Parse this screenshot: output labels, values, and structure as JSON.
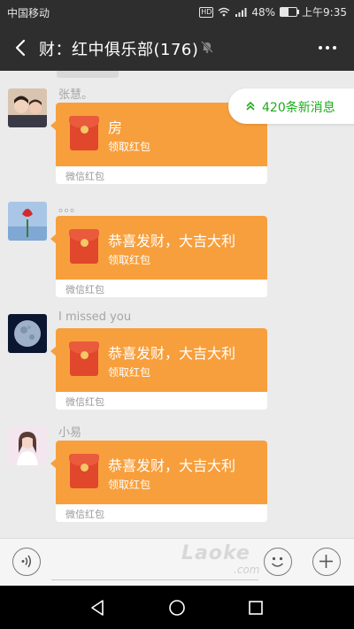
{
  "status_bar": {
    "carrier": "中国移动",
    "network_badge": "HD",
    "battery": "48%",
    "battery_level": 0.48,
    "time": "上午9:35"
  },
  "header": {
    "back_icon": "back-arrow-icon",
    "title": "财：红中俱乐部(176)",
    "mute_icon": "bell-muted-icon",
    "more_icon": "more-dots-icon"
  },
  "new_messages": {
    "icon": "double-chevron-up-icon",
    "label": "420条新消息"
  },
  "messages": [
    {
      "nickname": "张慧。",
      "packet_title": "房",
      "packet_action": "领取红包",
      "packet_footer": "微信红包"
    },
    {
      "nickname": "。。。",
      "packet_title": "恭喜发财，大吉大利",
      "packet_action": "领取红包",
      "packet_footer": "微信红包"
    },
    {
      "nickname": "I missed you",
      "packet_title": "恭喜发财，大吉大利",
      "packet_action": "领取红包",
      "packet_footer": "微信红包"
    },
    {
      "nickname": "小易",
      "packet_title": "恭喜发财，大吉大利",
      "packet_action": "领取红包",
      "packet_footer": "微信红包"
    }
  ],
  "input_bar": {
    "voice_icon": "voice-icon",
    "emoji_icon": "emoji-icon",
    "plus_icon": "plus-icon",
    "watermark": "Laoke",
    "watermark_sub": ".com"
  },
  "colors": {
    "packet_orange": "#f79f3c",
    "accent_green": "#1aad19",
    "header_dark": "#2e2e2e"
  }
}
